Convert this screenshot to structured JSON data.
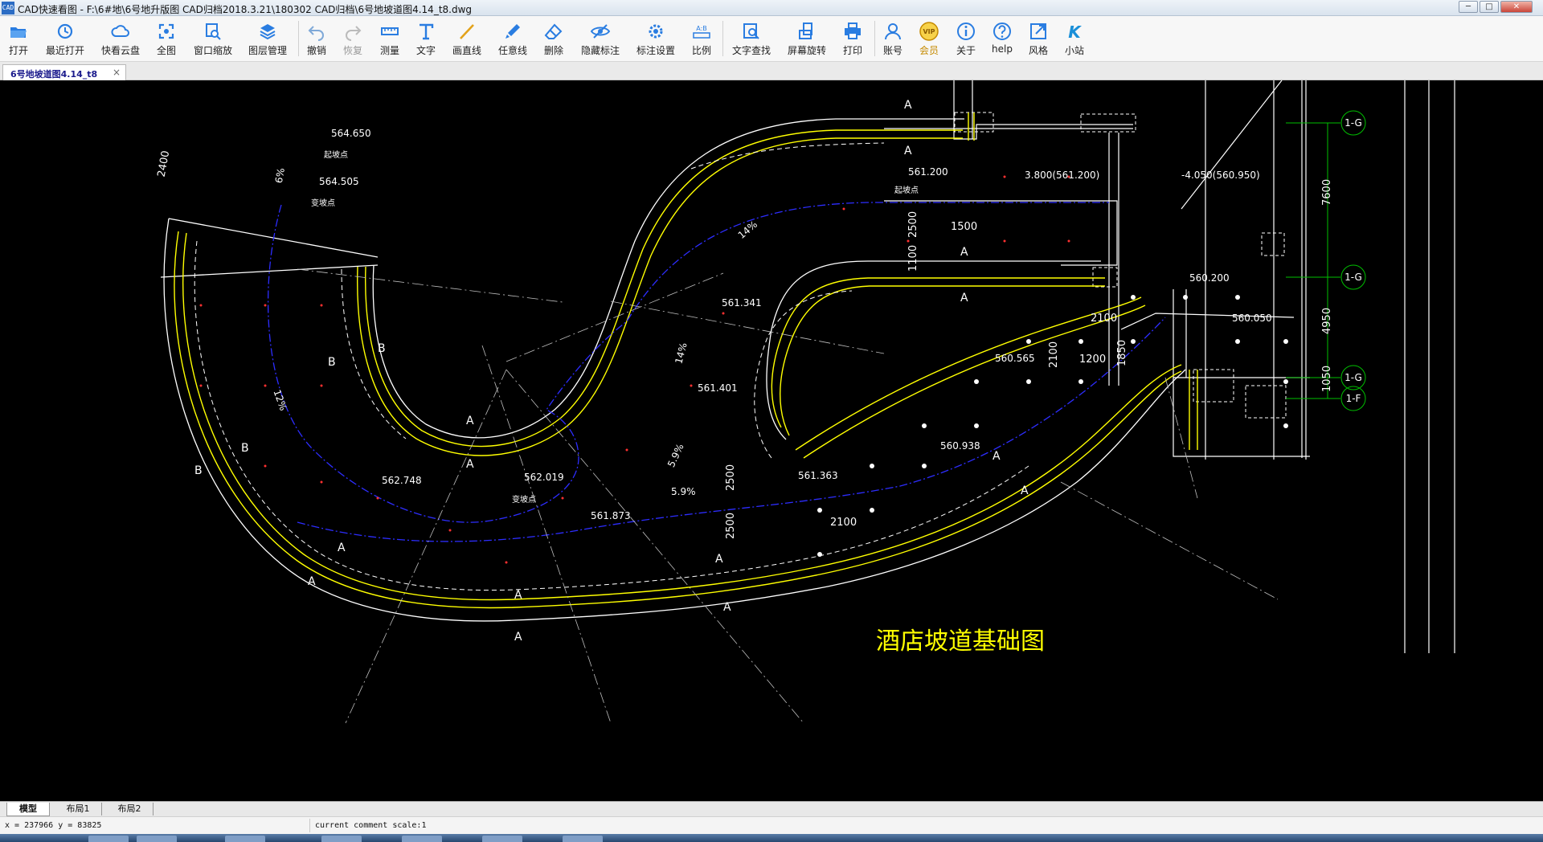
{
  "window": {
    "icon_text": "CAD",
    "title": "CAD快速看图 - F:\\6#地\\6号地升版图 CAD归档2018.3.21\\180302 CAD归档\\6号地坡道图4.14_t8.dwg",
    "minimize": "─",
    "maximize": "□",
    "close": "✕"
  },
  "toolbar": {
    "items": [
      {
        "key": "open",
        "label": "打开",
        "icon": "folder-icon"
      },
      {
        "key": "recent",
        "label": "最近打开",
        "icon": "history-icon"
      },
      {
        "key": "cloud",
        "label": "快看云盘",
        "icon": "cloud-icon"
      },
      {
        "key": "full",
        "label": "全图",
        "icon": "fullview-icon"
      },
      {
        "key": "winzoom",
        "label": "窗口缩放",
        "icon": "window-zoom-icon"
      },
      {
        "key": "layers",
        "label": "图层管理",
        "icon": "layers-icon"
      },
      {
        "key": "undo",
        "label": "撤销",
        "icon": "undo-icon"
      },
      {
        "key": "redo",
        "label": "恢复",
        "icon": "redo-icon"
      },
      {
        "key": "measure",
        "label": "测量",
        "icon": "ruler-icon"
      },
      {
        "key": "text",
        "label": "文字",
        "icon": "text-icon"
      },
      {
        "key": "line",
        "label": "画直线",
        "icon": "line-icon"
      },
      {
        "key": "freehand",
        "label": "任意线",
        "icon": "brush-icon"
      },
      {
        "key": "erase",
        "label": "删除",
        "icon": "eraser-icon"
      },
      {
        "key": "hidemark",
        "label": "隐藏标注",
        "icon": "eye-icon"
      },
      {
        "key": "marksettings",
        "label": "标注设置",
        "icon": "settings-icon"
      },
      {
        "key": "ratio",
        "label": "比例",
        "icon": "ratio-icon"
      },
      {
        "key": "findtext",
        "label": "文字查找",
        "icon": "find-text-icon"
      },
      {
        "key": "rotate",
        "label": "屏幕旋转",
        "icon": "rotate-icon"
      },
      {
        "key": "print",
        "label": "打印",
        "icon": "printer-icon"
      },
      {
        "key": "account",
        "label": "账号",
        "icon": "user-icon"
      },
      {
        "key": "vip",
        "label": "会员",
        "icon": "vip-icon"
      },
      {
        "key": "about",
        "label": "关于",
        "icon": "info-icon"
      },
      {
        "key": "help",
        "label": "help",
        "icon": "help-icon"
      },
      {
        "key": "style",
        "label": "风格",
        "icon": "style-icon"
      },
      {
        "key": "site",
        "label": "小站",
        "icon": "k-logo-icon"
      }
    ],
    "vip_badge": "VIP",
    "ratio_glyph": "A:B",
    "site_glyph": "K"
  },
  "document_tab": {
    "label": "6号地坡道图4.14_t8",
    "close": "×"
  },
  "drawing": {
    "title": "酒店坡道基础图",
    "colors": {
      "background": "#000000",
      "outline": "#ffffff",
      "lane": "#ffff00",
      "path": "#2d2dff",
      "dimension": "#00ff00",
      "axis": "#00c000"
    },
    "elevations": [
      "564.650",
      "564.505",
      "561.200",
      "3.800(561.200)",
      "-4.050(560.950)",
      "561.341",
      "561.401",
      "562.748",
      "562.019",
      "561.873",
      "561.363",
      "560.565",
      "560.938",
      "560.200",
      "560.050"
    ],
    "elevation_notes": [
      "起坡点",
      "变坡点",
      "起坡点",
      "变坡点"
    ],
    "slopes": [
      "6%",
      "12%",
      "14%",
      "14%",
      "5.9%",
      "5.9%"
    ],
    "dimensions": [
      "2400",
      "1500",
      "2500",
      "1100",
      "2100",
      "1200",
      "1850",
      "2100",
      "2500",
      "2500",
      "2100",
      "7600",
      "4950",
      "1050"
    ],
    "axis_labels": [
      "1-G",
      "1-G",
      "1-G",
      "1-F"
    ],
    "section_marks": [
      "A",
      "B"
    ]
  },
  "layout_tabs": [
    "模型",
    "布局1",
    "布局2"
  ],
  "status": {
    "coords": "x = 237966 y = 83825",
    "message": "current comment scale:1"
  }
}
